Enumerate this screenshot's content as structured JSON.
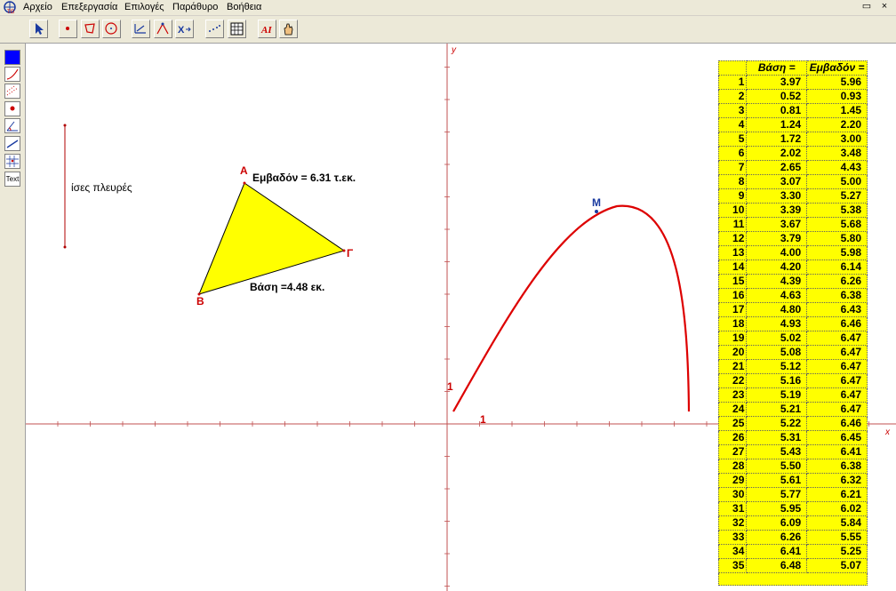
{
  "menubar": {
    "items": [
      "Αρχείο",
      "Επεξεργασία",
      "Επιλογές",
      "Παράθυρο",
      "Βοήθεια"
    ],
    "restore_glyph": "▭",
    "close_glyph": "×"
  },
  "toolbar": {
    "buttons": [
      "arrow-select",
      "point",
      "polygon",
      "circle",
      "measure",
      "locus",
      "transform",
      "dots",
      "table",
      "text-label",
      "hand"
    ]
  },
  "left_tools": [
    "color-blue",
    "curve",
    "dotted",
    "point-red",
    "angle",
    "line",
    "grid",
    "text"
  ],
  "left_tools_text_label": "Text",
  "canvas": {
    "segment_label": "ίσες πλευρές",
    "triangle": {
      "vertices": [
        "Α",
        "Β",
        "Γ"
      ],
      "area_text": "Εμβαδόν = 6.31   τ.εκ.",
      "base_text": "Βάση =4.48  εκ.",
      "fill": "#ffff00"
    },
    "axes": {
      "x_label": "x",
      "y_label": "y",
      "unit_x": "1",
      "unit_y": "1"
    },
    "curve": {
      "point_label": "Μ",
      "color": "#dd0000"
    }
  },
  "table": {
    "headers": [
      "",
      "Βάση =",
      "Εμβαδόν ="
    ],
    "rows": [
      [
        "1",
        "3.97",
        "5.96"
      ],
      [
        "2",
        "0.52",
        "0.93"
      ],
      [
        "3",
        "0.81",
        "1.45"
      ],
      [
        "4",
        "1.24",
        "2.20"
      ],
      [
        "5",
        "1.72",
        "3.00"
      ],
      [
        "6",
        "2.02",
        "3.48"
      ],
      [
        "7",
        "2.65",
        "4.43"
      ],
      [
        "8",
        "3.07",
        "5.00"
      ],
      [
        "9",
        "3.30",
        "5.27"
      ],
      [
        "10",
        "3.39",
        "5.38"
      ],
      [
        "11",
        "3.67",
        "5.68"
      ],
      [
        "12",
        "3.79",
        "5.80"
      ],
      [
        "13",
        "4.00",
        "5.98"
      ],
      [
        "14",
        "4.20",
        "6.14"
      ],
      [
        "15",
        "4.39",
        "6.26"
      ],
      [
        "16",
        "4.63",
        "6.38"
      ],
      [
        "17",
        "4.80",
        "6.43"
      ],
      [
        "18",
        "4.93",
        "6.46"
      ],
      [
        "19",
        "5.02",
        "6.47"
      ],
      [
        "20",
        "5.08",
        "6.47"
      ],
      [
        "21",
        "5.12",
        "6.47"
      ],
      [
        "22",
        "5.16",
        "6.47"
      ],
      [
        "23",
        "5.19",
        "6.47"
      ],
      [
        "24",
        "5.21",
        "6.47"
      ],
      [
        "25",
        "5.22",
        "6.46"
      ],
      [
        "26",
        "5.31",
        "6.45"
      ],
      [
        "27",
        "5.43",
        "6.41"
      ],
      [
        "28",
        "5.50",
        "6.38"
      ],
      [
        "29",
        "5.61",
        "6.32"
      ],
      [
        "30",
        "5.77",
        "6.21"
      ],
      [
        "31",
        "5.95",
        "6.02"
      ],
      [
        "32",
        "6.09",
        "5.84"
      ],
      [
        "33",
        "6.26",
        "5.55"
      ],
      [
        "34",
        "6.41",
        "5.25"
      ],
      [
        "35",
        "6.48",
        "5.07"
      ]
    ],
    "fill": "#ffff00"
  }
}
